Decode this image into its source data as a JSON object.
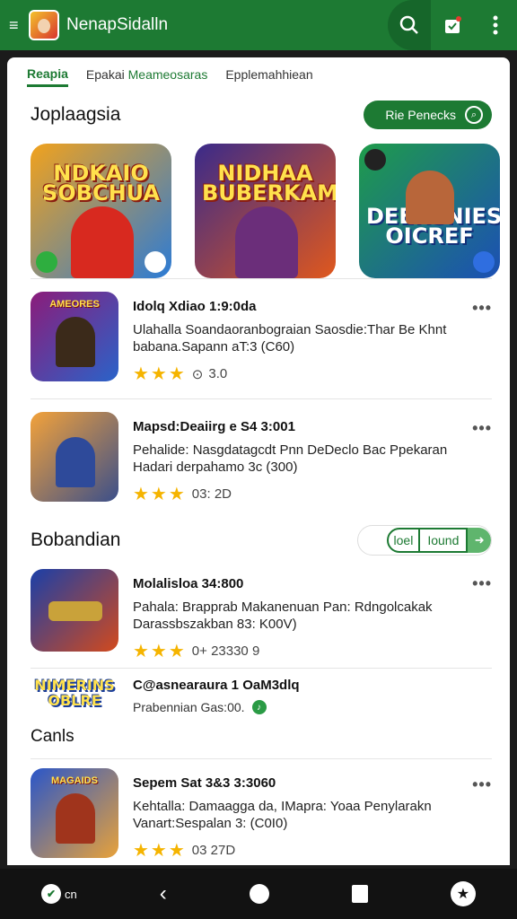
{
  "appbar": {
    "title": "NenapSidalln"
  },
  "tabs": [
    {
      "label": "Reapia"
    },
    {
      "label_prefix": "Epakai ",
      "label_highlight": "Meameosaras"
    },
    {
      "label": "Epplemahhiean"
    }
  ],
  "section1": {
    "title": "Joplaagsia",
    "button_label": "Rie Penecks"
  },
  "featured": [
    {
      "title": "NDKAIO SOBCHUA",
      "bg_from": "#f2a21c",
      "bg_to": "#2b7bd6"
    },
    {
      "title": "NIDHAA BUBERKAM",
      "bg_from": "#3a2a8a",
      "bg_to": "#e0581d"
    },
    {
      "title": "DEERSNIES OICREF",
      "bg_from": "#1f9c4a",
      "bg_to": "#1c4fb5"
    }
  ],
  "apps": [
    {
      "icon_tag": "AMEORES",
      "name": "Idolq Xdiao 1:9:0da",
      "desc1": "Ulahalla Soandaoranbograian Saosdie:Thar Be Khnt",
      "desc2": "babana.Sapann aT:3 (C60)",
      "stars": "★★★",
      "rating": "3.0",
      "bg_from": "#8b1c7a",
      "bg_to": "#2a63c9"
    },
    {
      "icon_tag": "",
      "name": "Mapsd:Deaiirg e S4 3:001",
      "desc1": "Pehalide: Nasgdatagcdt Pnn DeDeclo Bac Ppekaran",
      "desc2": "Hadari derpahamo 3c (300)",
      "stars": "★★★",
      "rating": "03: 2D",
      "bg_from": "#f3a23a",
      "bg_to": "#3b4f8a"
    }
  ],
  "section2": {
    "title": "Bobandian",
    "opt1": "loel",
    "opt2": "Iound"
  },
  "apps2": [
    {
      "icon_tag": "",
      "name": "Molalisloa 34:800",
      "desc1": "Pahala: Brapprab Makanenuan Pan: Rdngolcakak",
      "desc2": "Darassbszakban 83: K00V)",
      "stars": "★★★",
      "rating": "0+ 23330 9",
      "bg_from": "#1a3fa8",
      "bg_to": "#d24a1d"
    }
  ],
  "mini": {
    "icon_text": "NIMERINS OBLRE",
    "name": "C@asnearaura 1 OaM3dlq",
    "sub": "Prabennian Gas:00."
  },
  "cat_label": "Canls",
  "apps3": [
    {
      "icon_tag": "MAGAIDS",
      "name": "Sepem Sat 3&3 3:3060",
      "desc1": "Kehtalla: Damaagga da, IMapra: Yoaa Penylarakn",
      "desc2": "Vanart:Sespalan 3: (C0I0)",
      "stars": "★★★",
      "rating": "03 27D",
      "bg_from": "#2a56c9",
      "bg_to": "#e8a23a"
    }
  ],
  "navbar": {
    "left_label": "cn"
  },
  "colors": {
    "brand": "#1d7a33",
    "star": "#f5b400"
  }
}
